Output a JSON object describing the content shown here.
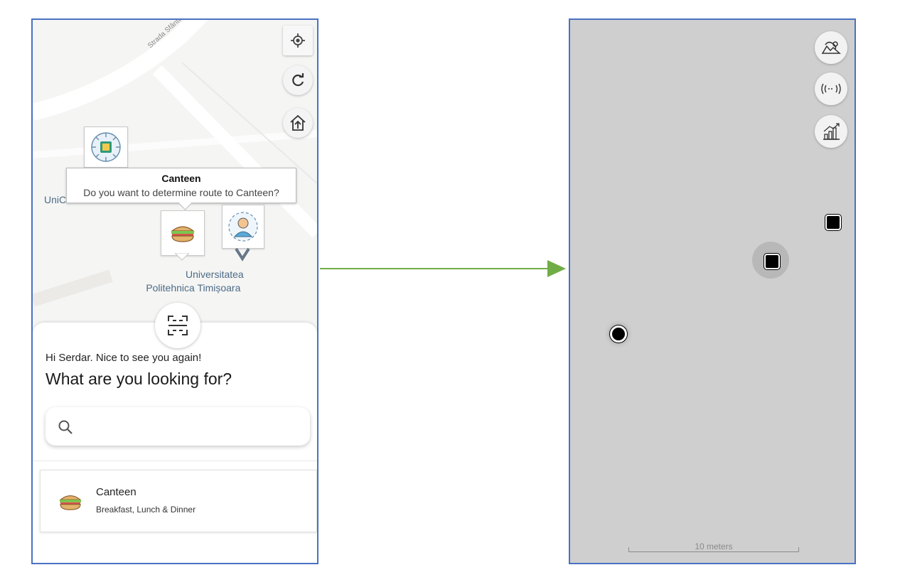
{
  "left_screen": {
    "map": {
      "street_label": "Strada Sfântul Ioan",
      "poi_partial_label": "UniCredit Bank",
      "campus_label_line1": "Universitatea",
      "campus_label_line2": "Politehnica Timișoara",
      "buttons": [
        {
          "name": "locate-me-button",
          "icon": "crosshair-icon"
        },
        {
          "name": "refresh-button",
          "icon": "refresh-icon"
        },
        {
          "name": "home-button",
          "icon": "home-icon"
        }
      ],
      "callout": {
        "title": "Canteen",
        "question": "Do you want to determine route to Canteen?"
      }
    },
    "sheet": {
      "greeting": "Hi Serdar. Nice to see you again!",
      "headline": "What are you looking for?",
      "search": {
        "value": "",
        "placeholder": ""
      },
      "results": [
        {
          "title": "Canteen",
          "subtitle": "Breakfast, Lunch & Dinner",
          "icon": "sandwich-icon"
        }
      ]
    }
  },
  "right_screen": {
    "buttons": [
      {
        "name": "map-layer-button",
        "icon": "map-icon"
      },
      {
        "name": "beacon-signal-button",
        "icon": "signal-waves-icon"
      },
      {
        "name": "stats-button",
        "icon": "chart-icon"
      }
    ],
    "scale_label": "10 meters"
  },
  "colors": {
    "panel_border": "#4a72c2",
    "arrow": "#70ad47",
    "right_map_bg": "#cfcfcf",
    "map_text": "#4b6b86"
  }
}
